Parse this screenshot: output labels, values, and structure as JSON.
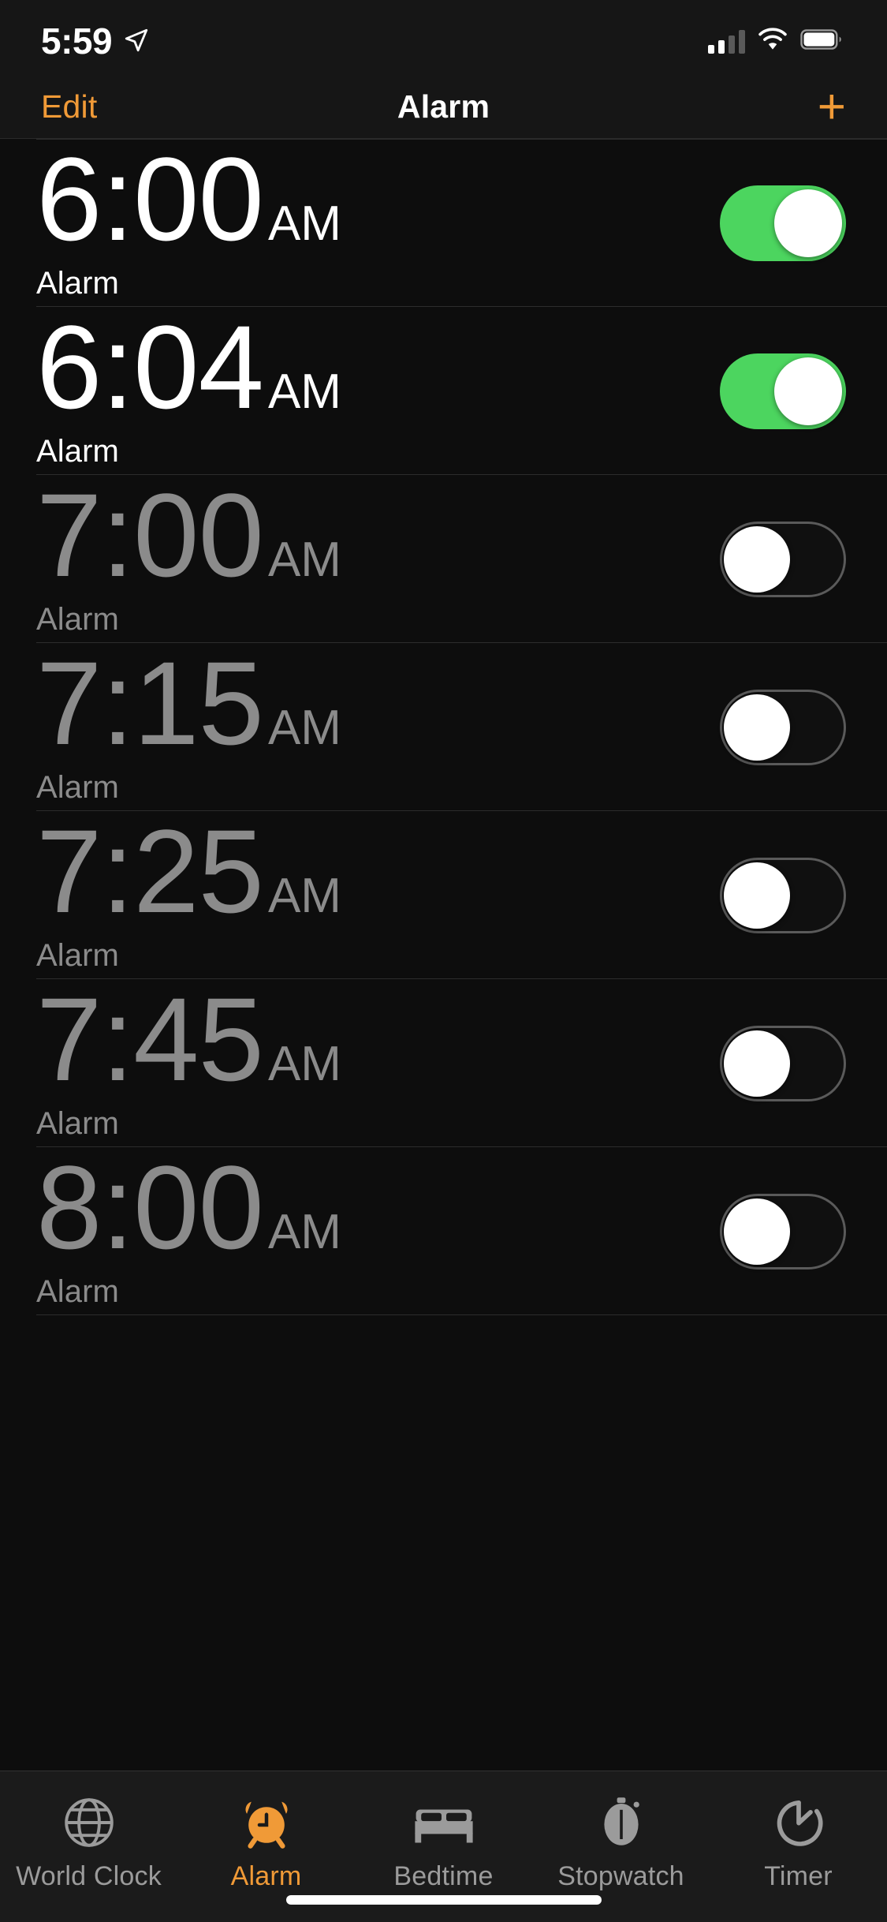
{
  "status_bar": {
    "time": "5:59",
    "location_icon": "location-arrow-icon",
    "cellular_icon": "cellular-signal-icon",
    "wifi_icon": "wifi-icon",
    "battery_icon": "battery-full-icon"
  },
  "nav_bar": {
    "edit_label": "Edit",
    "title": "Alarm",
    "add_label": "+"
  },
  "colors": {
    "accent_orange": "#f09a37",
    "toggle_on_green": "#4cd55f",
    "active_text": "#ffffff",
    "inactive_text": "#8b8b8b",
    "background": "#0d0d0d",
    "bar_background": "#1b1b1b"
  },
  "alarms": [
    {
      "time": "6:00",
      "meridiem": "AM",
      "label": "Alarm",
      "enabled": true
    },
    {
      "time": "6:04",
      "meridiem": "AM",
      "label": "Alarm",
      "enabled": true
    },
    {
      "time": "7:00",
      "meridiem": "AM",
      "label": "Alarm",
      "enabled": false
    },
    {
      "time": "7:15",
      "meridiem": "AM",
      "label": "Alarm",
      "enabled": false
    },
    {
      "time": "7:25",
      "meridiem": "AM",
      "label": "Alarm",
      "enabled": false
    },
    {
      "time": "7:45",
      "meridiem": "AM",
      "label": "Alarm",
      "enabled": false
    },
    {
      "time": "8:00",
      "meridiem": "AM",
      "label": "Alarm",
      "enabled": false
    }
  ],
  "tab_bar": {
    "items": [
      {
        "label": "World Clock",
        "icon": "globe-icon",
        "active": false
      },
      {
        "label": "Alarm",
        "icon": "alarm-clock-icon",
        "active": true
      },
      {
        "label": "Bedtime",
        "icon": "bed-icon",
        "active": false
      },
      {
        "label": "Stopwatch",
        "icon": "stopwatch-icon",
        "active": false
      },
      {
        "label": "Timer",
        "icon": "timer-icon",
        "active": false
      }
    ]
  }
}
